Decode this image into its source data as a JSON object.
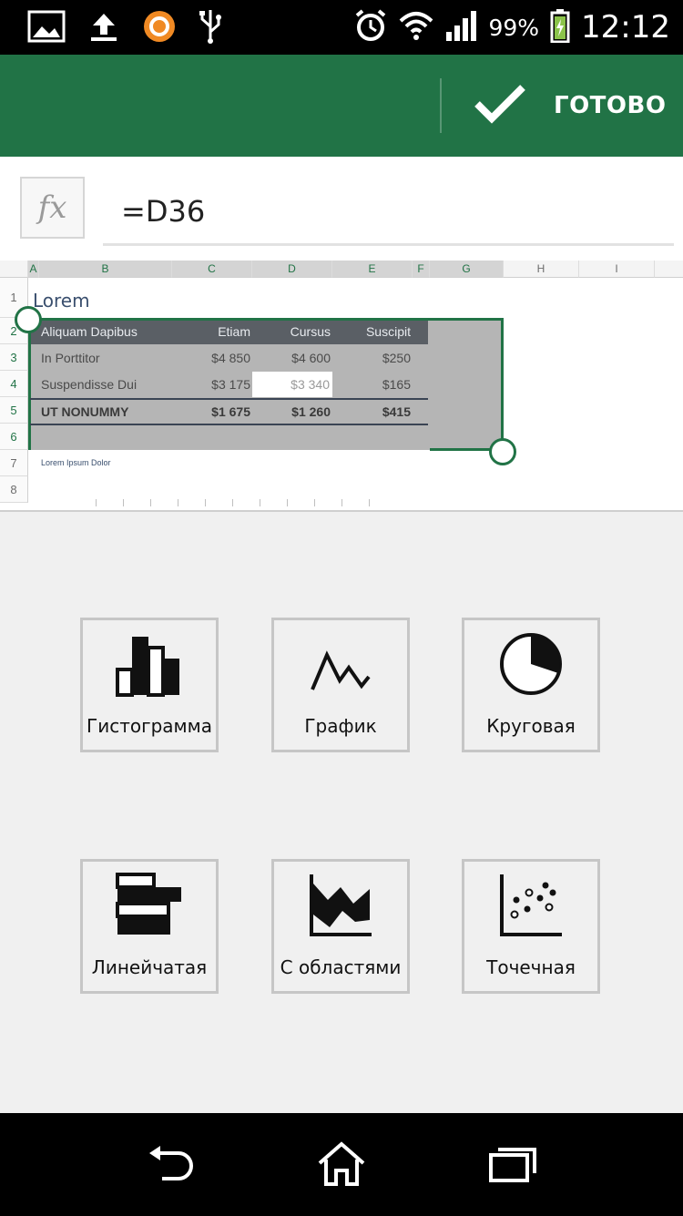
{
  "status_bar": {
    "time": "12:12",
    "battery": "99%",
    "left_icons": [
      "image-icon",
      "upload-icon",
      "avast-icon",
      "usb-icon"
    ],
    "right_icons": [
      "alarm-icon",
      "wifi-icon",
      "signal-icon",
      "battery-charging-icon"
    ]
  },
  "action_bar": {
    "done_label": "ГОТОВО",
    "accent": "#217346"
  },
  "formula_bar": {
    "fx_label": "fx",
    "value": "=D36"
  },
  "sheet": {
    "columns": [
      "A",
      "B",
      "C",
      "D",
      "E",
      "F",
      "G",
      "H",
      "I"
    ],
    "rows": [
      "1",
      "2",
      "3",
      "4",
      "5",
      "6",
      "7",
      "8"
    ],
    "title": "Lorem",
    "header": [
      "Aliquam Dapibus",
      "Etiam",
      "Cursus",
      "Suscipit"
    ],
    "row3": [
      "In Porttitor",
      "$4 850",
      "$4 600",
      "$250"
    ],
    "row4": [
      "Suspendisse Dui",
      "$3 175",
      "$3 340",
      "$165"
    ],
    "row5": [
      "UT NONUMMY",
      "$1 675",
      "$1 260",
      "$415"
    ],
    "note": "Lorem Ipsum Dolor"
  },
  "chart_types": [
    {
      "label": "Гистограмма",
      "icon": "column-chart-icon"
    },
    {
      "label": "График",
      "icon": "line-chart-icon"
    },
    {
      "label": "Круговая",
      "icon": "pie-chart-icon"
    },
    {
      "label": "Линейчатая",
      "icon": "bar-chart-icon"
    },
    {
      "label": "С областями",
      "icon": "area-chart-icon"
    },
    {
      "label": "Точечная",
      "icon": "scatter-chart-icon"
    }
  ],
  "nav_bar": {
    "buttons": [
      "back-icon",
      "home-icon",
      "recents-icon"
    ]
  }
}
